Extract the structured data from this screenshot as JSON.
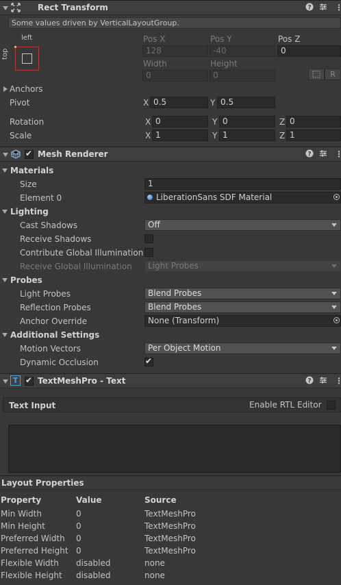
{
  "rect_transform": {
    "title": "Rect Transform",
    "info": "Some values driven by VerticalLayoutGroup.",
    "anchor_preset": {
      "horizontal": "left",
      "vertical": "top"
    },
    "col_labels": {
      "pos_x": "Pos X",
      "pos_y": "Pos Y",
      "pos_z": "Pos Z",
      "width": "Width",
      "height": "Height"
    },
    "values": {
      "pos_x": "128",
      "pos_y": "-40",
      "pos_z": "0",
      "width": "0",
      "height": "0"
    },
    "r_button": "R",
    "anchors_label": "Anchors",
    "pivot_label": "Pivot",
    "pivot": {
      "x_label": "X",
      "x": "0.5",
      "y_label": "Y",
      "y": "0.5"
    },
    "rotation_label": "Rotation",
    "rotation": {
      "x_label": "X",
      "x": "0",
      "y_label": "Y",
      "y": "0",
      "z_label": "Z",
      "z": "0"
    },
    "scale_label": "Scale",
    "scale": {
      "x_label": "X",
      "x": "1",
      "y_label": "Y",
      "y": "1",
      "z_label": "Z",
      "z": "1"
    }
  },
  "mesh_renderer": {
    "title": "Mesh Renderer",
    "enabled": true,
    "materials": {
      "label": "Materials",
      "size_label": "Size",
      "size": "1",
      "element0_label": "Element 0",
      "element0": "LiberationSans SDF Material"
    },
    "lighting": {
      "label": "Lighting",
      "cast_shadows_label": "Cast Shadows",
      "cast_shadows": "Off",
      "receive_shadows_label": "Receive Shadows",
      "receive_shadows": false,
      "contribute_gi_label": "Contribute Global Illumination",
      "contribute_gi": false,
      "receive_gi_label": "Receive Global Illumination",
      "receive_gi": "Light Probes"
    },
    "probes": {
      "label": "Probes",
      "light_probes_label": "Light Probes",
      "light_probes": "Blend Probes",
      "reflection_probes_label": "Reflection Probes",
      "reflection_probes": "Blend Probes",
      "anchor_override_label": "Anchor Override",
      "anchor_override": "None (Transform)"
    },
    "additional": {
      "label": "Additional Settings",
      "motion_vectors_label": "Motion Vectors",
      "motion_vectors": "Per Object Motion",
      "dynamic_occlusion_label": "Dynamic Occlusion",
      "dynamic_occlusion": true
    }
  },
  "textmeshpro": {
    "title": "TextMeshPro - Text",
    "enabled": true,
    "text_input_label": "Text Input",
    "rtl_label": "Enable RTL Editor",
    "rtl": false,
    "text_value": ""
  },
  "layout_properties": {
    "title": "Layout Properties",
    "headers": [
      "Property",
      "Value",
      "Source"
    ],
    "rows": [
      [
        "Min Width",
        "0",
        "TextMeshPro"
      ],
      [
        "Min Height",
        "0",
        "TextMeshPro"
      ],
      [
        "Preferred Width",
        "0",
        "TextMeshPro"
      ],
      [
        "Preferred Height",
        "0",
        "TextMeshPro"
      ],
      [
        "Flexible Width",
        "disabled",
        "none"
      ],
      [
        "Flexible Height",
        "disabled",
        "none"
      ]
    ]
  },
  "header_icons": [
    "help-icon",
    "preset-icon",
    "kebab-menu-icon"
  ],
  "colors": {
    "background": "#383838",
    "header": "#3e3e3e",
    "field": "#2a2a2a",
    "dropdown": "#515151",
    "accent": "#3a79bb"
  }
}
